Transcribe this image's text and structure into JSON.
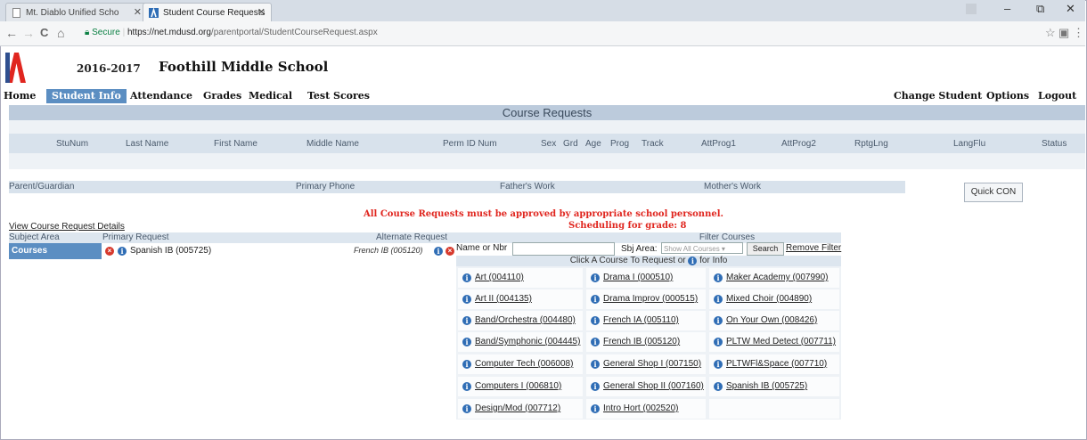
{
  "browser": {
    "tabs": [
      {
        "title": "Mt. Diablo Unified Scho",
        "active": false
      },
      {
        "title": "Student Course Requests",
        "active": true
      }
    ],
    "secure_label": "Secure",
    "url_host": "https://net.mdusd.org",
    "url_path": "/parentportal/StudentCourseRequest.aspx",
    "nav_back": "←",
    "nav_forward": "→",
    "nav_reload": "C",
    "nav_home": "⌂",
    "win_min": "–",
    "win_max": "⧉",
    "win_close": "✕",
    "star": "☆",
    "ext": "▣",
    "menu": "⋮"
  },
  "header": {
    "year": "2016-2017",
    "school": "Foothill Middle School"
  },
  "menu": {
    "left": [
      "Home",
      "Student Info",
      "Attendance",
      "Grades",
      "Medical",
      "Test Scores"
    ],
    "selected": "Student Info",
    "right": [
      "Change Student",
      "Options",
      "Logout"
    ]
  },
  "course_requests_title": "Course Requests",
  "student_columns": [
    "StuNum",
    "Last Name",
    "First Name",
    "Middle Name",
    "Perm ID Num",
    "Sex",
    "Grd",
    "Age",
    "Prog",
    "Track",
    "AttProg1",
    "AttProg2",
    "RptgLng",
    "LangFlu",
    "Status"
  ],
  "contact_columns": [
    "Parent/Guardian",
    "Primary Phone",
    "Father's Work",
    "Mother's Work"
  ],
  "quick_con_label": "Quick CON",
  "warning": "All Course Requests must be approved by appropriate school personnel.",
  "scheduling": "Scheduling for grade: 8",
  "view_details_link": "View Course Request Details",
  "table_headers": {
    "subject_area": "Subject Area",
    "primary": "Primary Request",
    "alternate": "Alternate Request"
  },
  "courses_label": "Courses",
  "primary_request": "Spanish IB (005725)",
  "alternate_request": "French IB (005120)",
  "filter": {
    "title": "Filter Courses",
    "name_label": "Name or Nbr",
    "name_value": "",
    "sbj_label": "Sbj Area:",
    "sbj_value": "Show All Courses ▾",
    "search_label": "Search",
    "remove_label": "Remove Filter"
  },
  "click_hint_a": "Click A Course To Request or",
  "click_hint_b": "for Info",
  "course_grid": [
    [
      "Art (004110)",
      "Drama I (000510)",
      "Maker Academy (007990)"
    ],
    [
      "Art II (004135)",
      "Drama Improv (000515)",
      "Mixed Choir (004890)"
    ],
    [
      "Band/Orchestra (004480)",
      "French IA (005110)",
      "On Your Own (008426)"
    ],
    [
      "Band/Symphonic (004445)",
      "French IB (005120)",
      "PLTW Med Detect (007711)"
    ],
    [
      "Computer Tech (006008)",
      "General Shop I (007150)",
      "PLTWFl&Space (007710)"
    ],
    [
      "Computers I (006810)",
      "General Shop II (007160)",
      "Spanish IB (005725)"
    ],
    [
      "Design/Mod (007712)",
      "Intro Hort (002520)",
      ""
    ]
  ],
  "colors": {
    "accent": "#5b8ec2",
    "header_band": "#bccbdc",
    "warning": "#e0261f",
    "info_icon": "#2f6db5",
    "remove_icon": "#d73a2d"
  }
}
